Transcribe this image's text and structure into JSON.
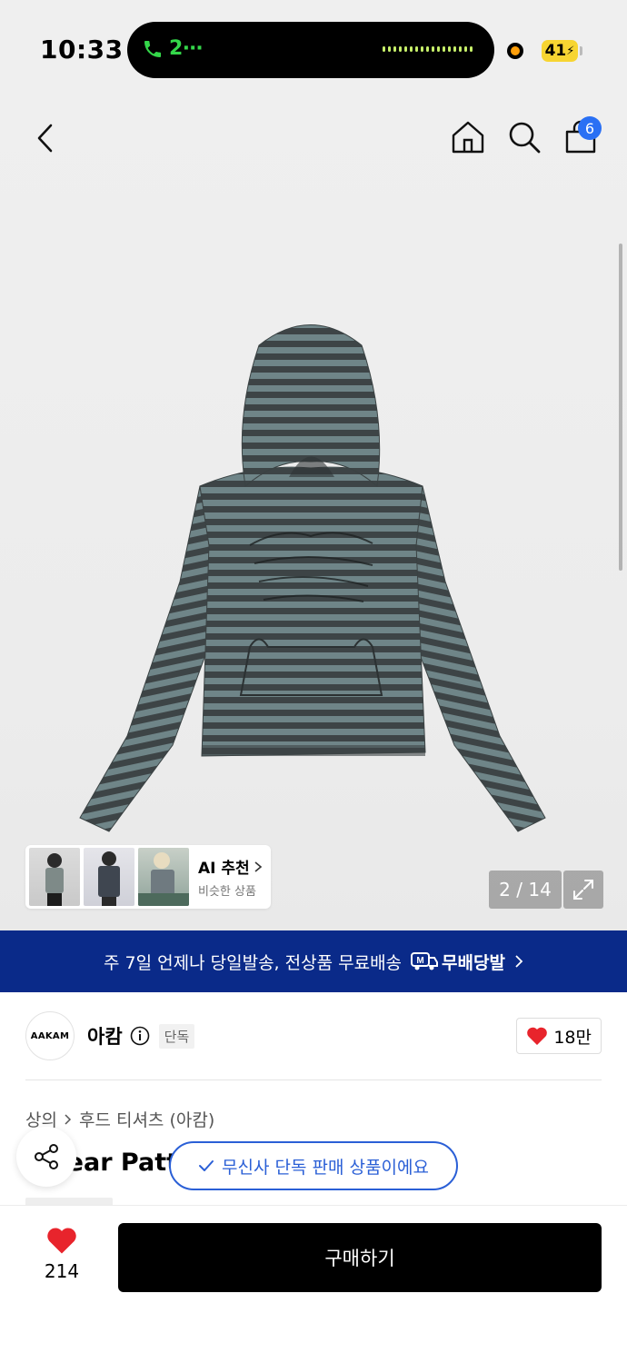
{
  "status_bar": {
    "time": "10:33",
    "call_indicator": "2⋯",
    "battery": "41"
  },
  "nav": {
    "cart_count": "6"
  },
  "gallery": {
    "counter": "2 / 14",
    "product_image_desc": "striped gray hoodie with print"
  },
  "ai_recommend": {
    "title": "AI 추천",
    "subtitle": "비슷한 상품"
  },
  "banner": {
    "text": "주 7일 언제나 당일발송, 전상품 무료배송",
    "brand": "무배당발",
    "brand_icon": "M"
  },
  "brand": {
    "logo_text": "AAKAM",
    "name": "아캄",
    "tag": "단독",
    "likes": "18만"
  },
  "product": {
    "category": "상의",
    "subcategory": "후드 티셔츠 (아캄)",
    "title": "Linear Pattern Hoodie (Gray)"
  },
  "toast": {
    "text": "무신사 단독 판매 상품이에요"
  },
  "bottom_bar": {
    "wish_count": "214",
    "buy_label": "구매하기"
  },
  "colors": {
    "accent_blue": "#2a70f4",
    "banner_navy": "#0a2a89",
    "heart_red": "#e8242c",
    "battery_yellow": "#f7d532"
  }
}
